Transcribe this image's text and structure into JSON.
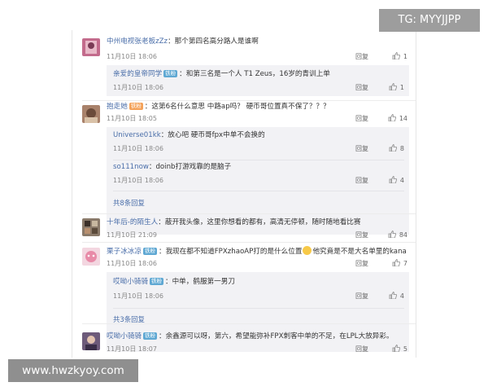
{
  "watermark_top": "TG: MYYJJPP",
  "watermark_bottom": "www.hwzkyoy.com",
  "reply_label": "回复",
  "comments": [
    {
      "user": "中州电视张老板zZz",
      "text": "：那个第四名高分路人是谁啊",
      "time": "11月10日 18:06",
      "likes": "1",
      "replies": [
        {
          "user": "亲爱的皇帝同学",
          "badge": "铁粉",
          "text": "：和第三名是一个人 T1 Zeus，16岁的青训上单",
          "time": "11月10日 18:06",
          "likes": "1"
        }
      ]
    },
    {
      "user": "抱走她",
      "badge": "铁粉",
      "text": "：这第6名什么意思 中路ap吗？ 硬币哥位置真不保了？？？",
      "time": "11月10日 18:05",
      "likes": "14",
      "replies": [
        {
          "user": "Universe01kk",
          "text": "：放心吧 硬币哥fpx中单不会换的",
          "time": "11月10日 18:06",
          "likes": "8"
        },
        {
          "user": "so111now",
          "text": "：doinb打游戏靠的是脑子",
          "time": "11月10日 18:06",
          "likes": "4"
        }
      ],
      "more": "共8条回复"
    },
    {
      "user": "十年后-的陌生人",
      "text": "：蔽开我头像，这里你想看的都有，高清无停顿，随时随地看比赛",
      "time": "11月10日 21:09",
      "likes": "84"
    },
    {
      "user": "栗子冰冰凉",
      "badge": "铁粉",
      "text_a": "：我现在都不知道FPXzhaoAP打的是什么位置",
      "text_b": "他究竟是不是大名单里的kana",
      "time": "11月10日 18:06",
      "likes": "7",
      "replies": [
        {
          "user": "哎呦小骑骑",
          "badge": "铁粉",
          "text": "：中单，鹤服第一男刀",
          "time": "11月10日 18:06",
          "likes": "4"
        }
      ],
      "more": "共3条回复"
    },
    {
      "user": "哎呦小骑骑",
      "badge": "铁粉",
      "text": "：余鑫源可以呀，第六，希望能弥补FPX刺客中单的不足，在LPL大放异彩。",
      "time": "11月10日 18:07",
      "likes": "5"
    }
  ]
}
